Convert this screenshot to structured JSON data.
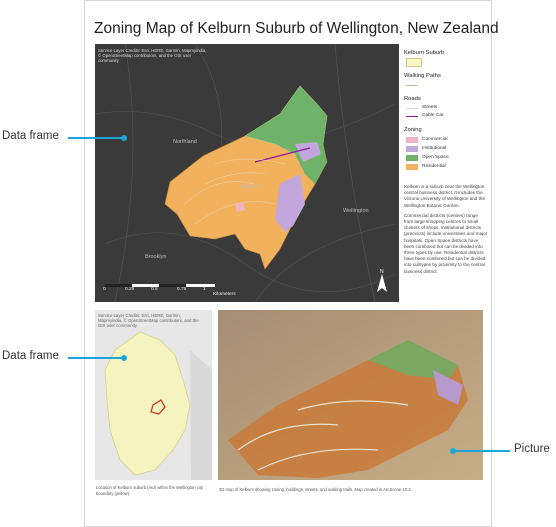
{
  "map_title": "Zoning Map of Kelburn Suburb of Wellington, New Zealand",
  "main_map": {
    "credit": "Service Layer Credits: Esri, HERE, Garmin, Mapmyindia, © OpenStreetMap contributors, and the GIS user community",
    "places": [
      "Northland",
      "Kelburn",
      "Wellington",
      "Brooklyn"
    ],
    "scale_labels": [
      "0",
      "0.25",
      "0.5",
      "0.75",
      "1"
    ],
    "scale_unit": "Kilometers",
    "north": "N"
  },
  "legend": {
    "suburbs_heading": "Kelburn Suburb",
    "paths_heading": "Walking Paths",
    "roads_heading": "Roads",
    "roads": [
      {
        "label": "Streets",
        "color": "#d9d9d9"
      },
      {
        "label": "Cable Car",
        "color": "#8b1aa0"
      }
    ],
    "zoning_heading": "Zoning",
    "zoning": [
      {
        "label": "Commercial",
        "color": "#f2b3c8"
      },
      {
        "label": "Institutional",
        "color": "#c3a6dc"
      },
      {
        "label": "Open Space",
        "color": "#6fb36a"
      },
      {
        "label": "Residential",
        "color": "#f2b25d"
      }
    ],
    "suburb_color": "#fbf7c9",
    "path_color": "#9dd18a"
  },
  "description": [
    "Kelburn is a suburb near the Wellington central business district. It includes the Victoria University of Wellington and the Wellington Botanic Garden.",
    "Commercial districts (centres) range from large shopping centres to small clusters of shops. Institutional districts (precincts) include universities and major hospitals. Open Space districts have been combined but can be divided into three types by use. Residential districts have been combined but can be divided into subtypes by proximity to the central business district."
  ],
  "inset_map": {
    "credit": "Service Layer Credits: Esri, HERE, Garmin, Mapmyindia, © OpenStreetMap contributors, and the GIS user community",
    "caption": "Location of Kelburn suburb (red) within the Wellington city boundary (yellow)."
  },
  "picture": {
    "caption": "3D map of Kelburn showing zoning, buildings, streets, and walking trails. Map created in ArcScene 10.3."
  },
  "callouts": [
    {
      "label": "Data frame",
      "target": "main-map"
    },
    {
      "label": "Data frame",
      "target": "inset-map"
    },
    {
      "label": "Picture",
      "target": "3d-picture"
    }
  ]
}
